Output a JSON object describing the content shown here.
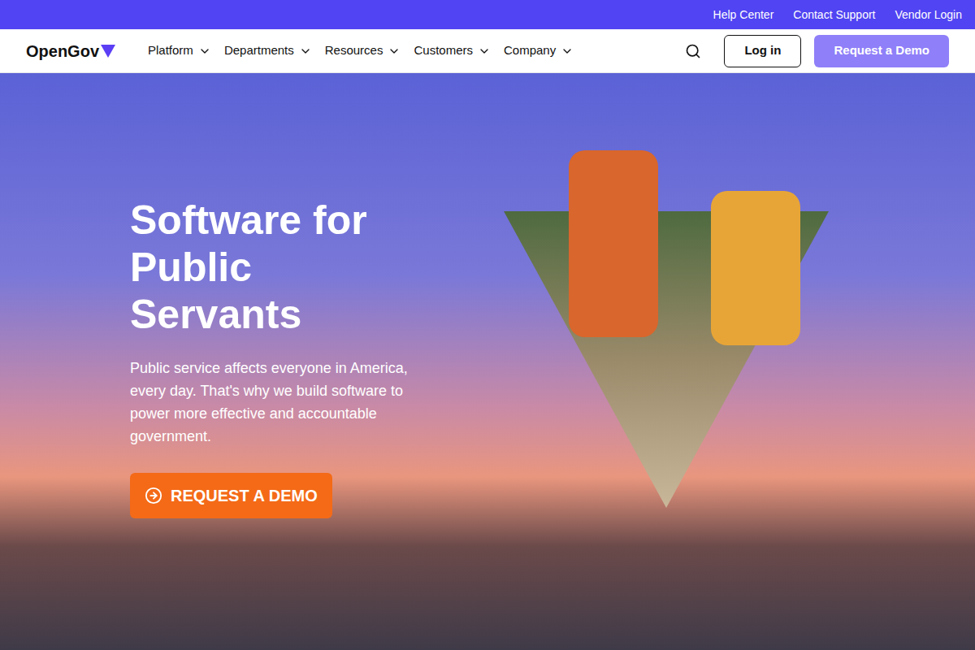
{
  "utility_bar": {
    "links": [
      "Help Center",
      "Contact Support",
      "Vendor Login"
    ]
  },
  "nav": {
    "logo": "OpenGov",
    "menu": [
      "Platform",
      "Departments",
      "Resources",
      "Customers",
      "Company"
    ],
    "login": "Log in",
    "demo": "Request a Demo"
  },
  "hero": {
    "heading": "Software for Public Servants",
    "subtext": "Public service affects everyone in America, every day. That's why we build software to power more effective and accountable government.",
    "cta": "REQUEST A DEMO"
  }
}
